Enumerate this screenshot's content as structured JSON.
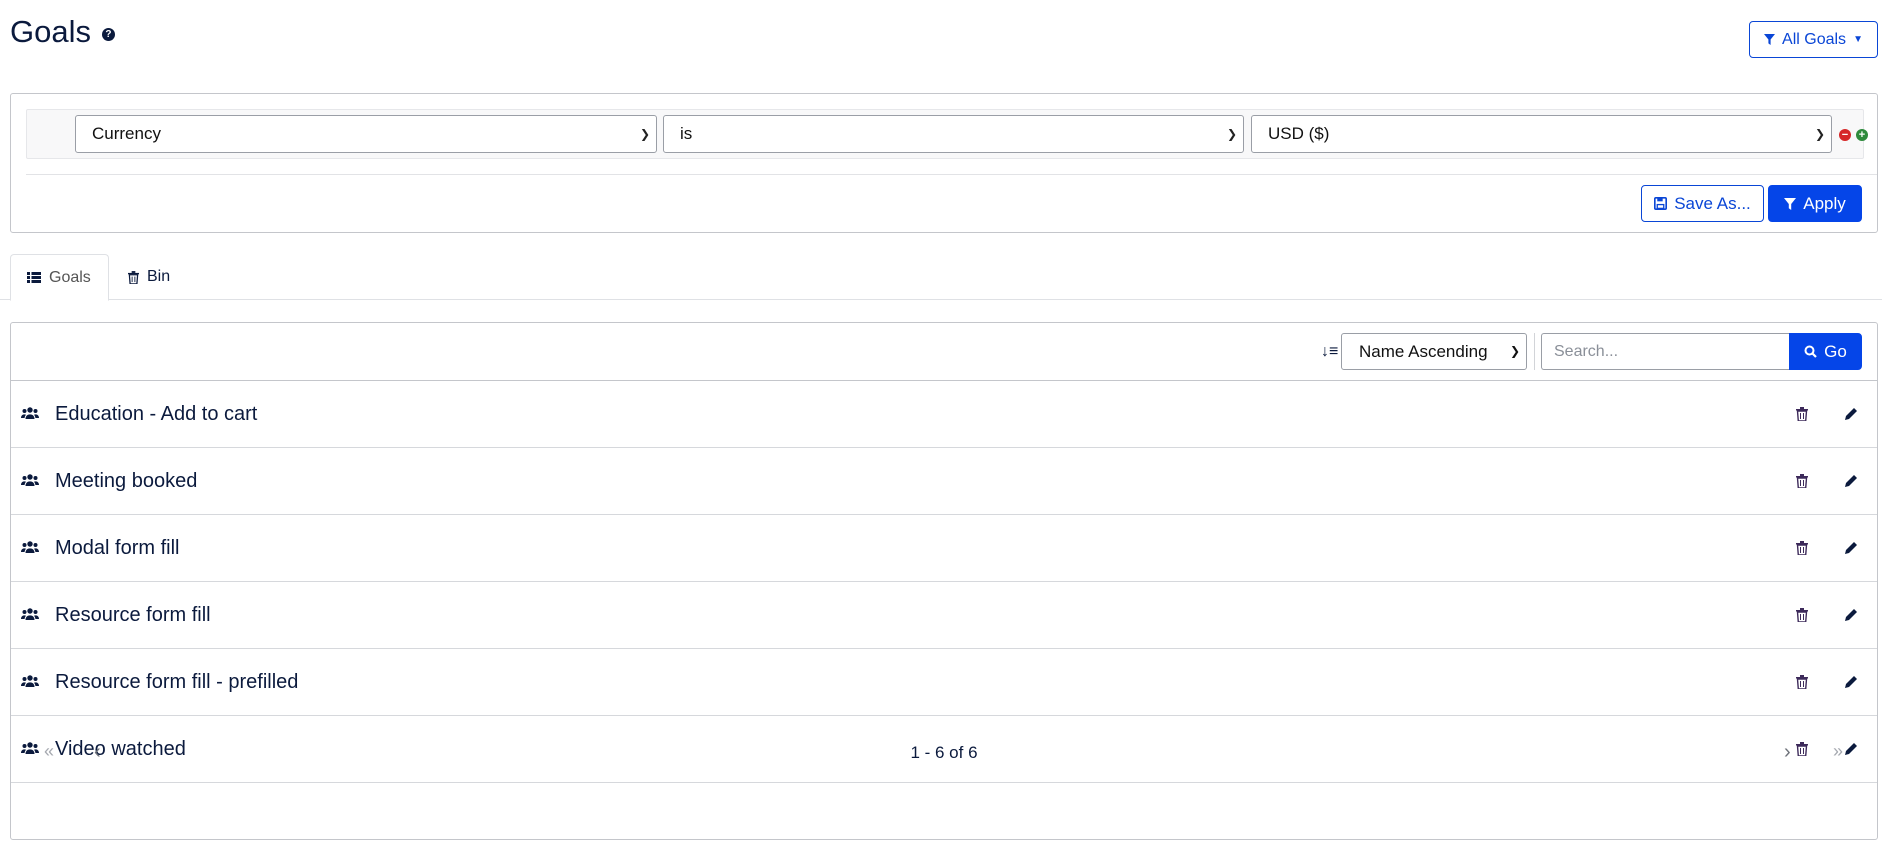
{
  "header": {
    "title": "Goals",
    "help_glyph": "?",
    "all_goals_label": "All Goals"
  },
  "filter": {
    "field": "Currency",
    "operator": "is",
    "value": "USD ($)",
    "save_as_label": "Save As...",
    "apply_label": "Apply"
  },
  "tabs": [
    {
      "label": "Goals"
    },
    {
      "label": "Bin"
    }
  ],
  "toolbar": {
    "sort_value": "Name Ascending",
    "search_placeholder": "Search...",
    "go_label": "Go"
  },
  "goals": [
    {
      "name": "Education - Add to cart"
    },
    {
      "name": "Meeting booked"
    },
    {
      "name": "Modal form fill"
    },
    {
      "name": "Resource form fill"
    },
    {
      "name": "Resource form fill - prefilled"
    },
    {
      "name": "Video watched"
    }
  ],
  "pagination": {
    "first": "«",
    "prev": "‹",
    "next": "›",
    "last": "»",
    "summary": "1 - 6 of 6"
  },
  "colors": {
    "primary": "#0545e8",
    "text": "#0b1a3d",
    "remove": "#d62728",
    "add": "#2e8b3c"
  }
}
